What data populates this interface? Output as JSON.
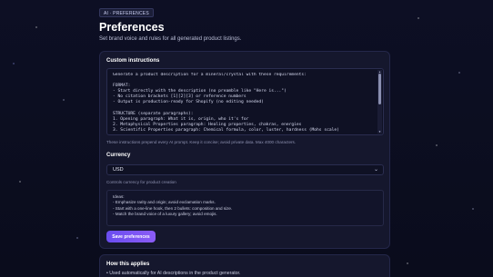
{
  "header": {
    "badge": "AI · PREFERENCES",
    "title": "Preferences",
    "subtitle": "Set brand voice and rules for all generated product listings."
  },
  "custom_instructions": {
    "label": "Custom instructions",
    "text": "Generate a product description for a mineral/crystal with these requirements:\n\nFORMAT:\n- Start directly with the description (no preamble like \"Here is...\")\n- No citation brackets [1][2][3] or reference numbers\n- Output is production-ready for Shopify (no editing needed)\n\nSTRUCTURE (separate paragraphs):\n1. Opening paragraph: What it is, origin, who it's for\n2. Metaphysical Properties paragraph: Healing properties, chakras, energies\n3. Scientific Properties paragraph: Chemical formula, color, luster, hardness (Mohs scale)",
    "hint": "These instructions prepend every AI prompt. Keep it concise; avoid private data. Max 4000 characters."
  },
  "currency": {
    "label": "Currency",
    "selected": "USD",
    "hint": "Controls currency for product creation"
  },
  "ideas": {
    "lines": [
      "Ideas:",
      "- Emphasize rarity and origin; avoid exclamation marks.",
      "- Start with a one-line hook, then 2 bullets: composition and size.",
      "- Match the brand voice of a luxury gallery; avoid emojis."
    ]
  },
  "save_button": "Save preferences",
  "how_applies": {
    "label": "How this applies",
    "items": [
      "• Used automatically for AI descriptions in the product generator."
    ]
  },
  "icons": {
    "chevron": "chevron-down-icon",
    "scroll_up": "scroll-up-arrow-icon",
    "scroll_down": "scroll-down-arrow-icon"
  },
  "colors": {
    "accent_start": "#6a4df0",
    "accent_end": "#8b5cf6",
    "background": "#0b0d1f",
    "card": "#15172d"
  }
}
